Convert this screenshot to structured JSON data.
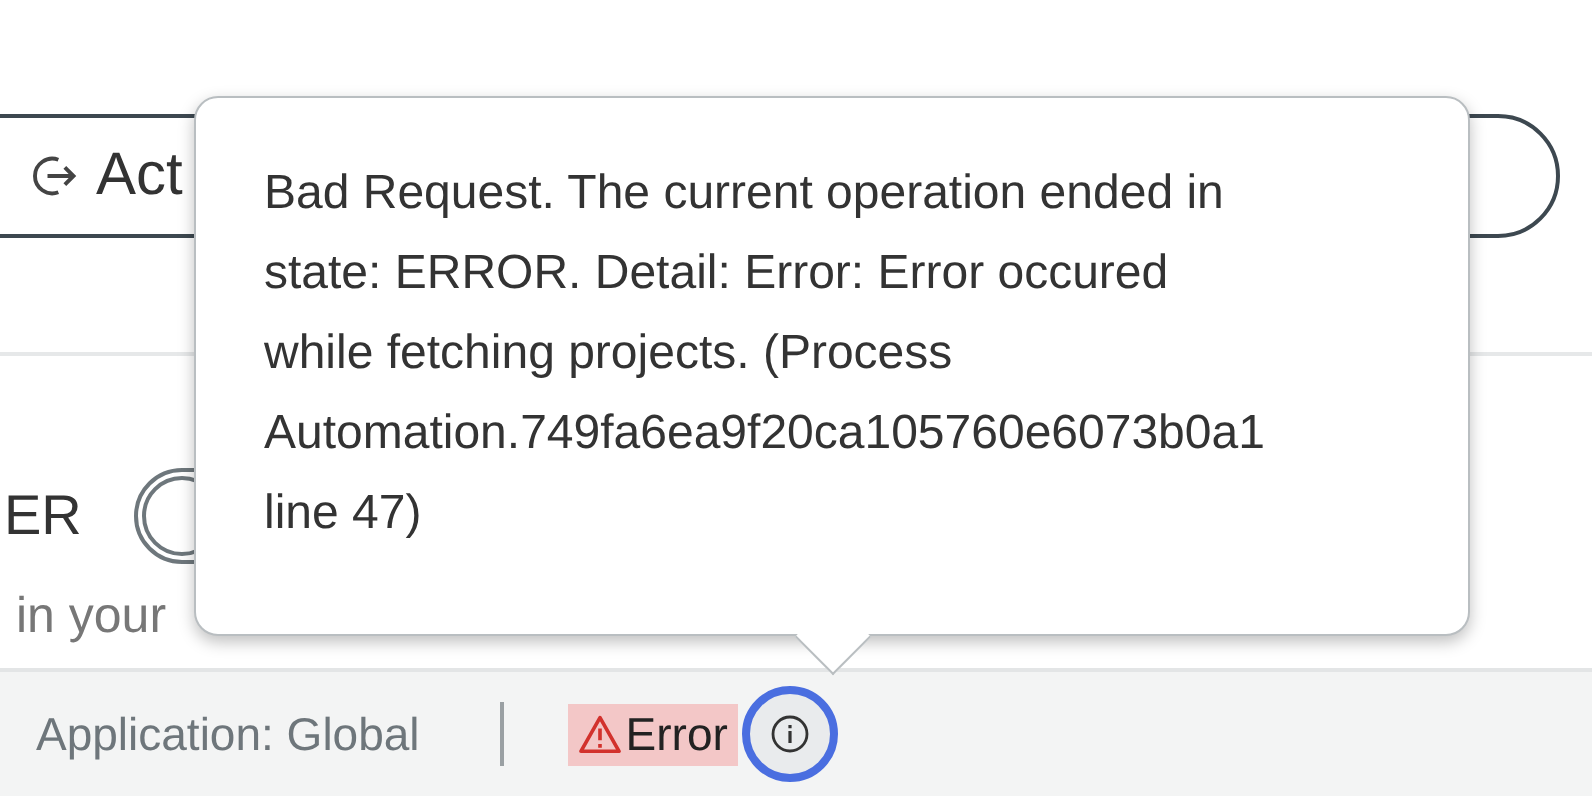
{
  "action_button": {
    "label": "Act"
  },
  "setting": {
    "label": "ER",
    "description": "in your",
    "on": false
  },
  "status_bar": {
    "application": "Application: Global",
    "status": {
      "kind": "error",
      "label": "Error"
    }
  },
  "tooltip": {
    "text": "Bad Request. The current operation ended in state: ERROR. Detail: Error: Error occured while fetching projects. (Process Automation.749fa6ea9f20ca105760e6073b0a1 line 47)"
  }
}
